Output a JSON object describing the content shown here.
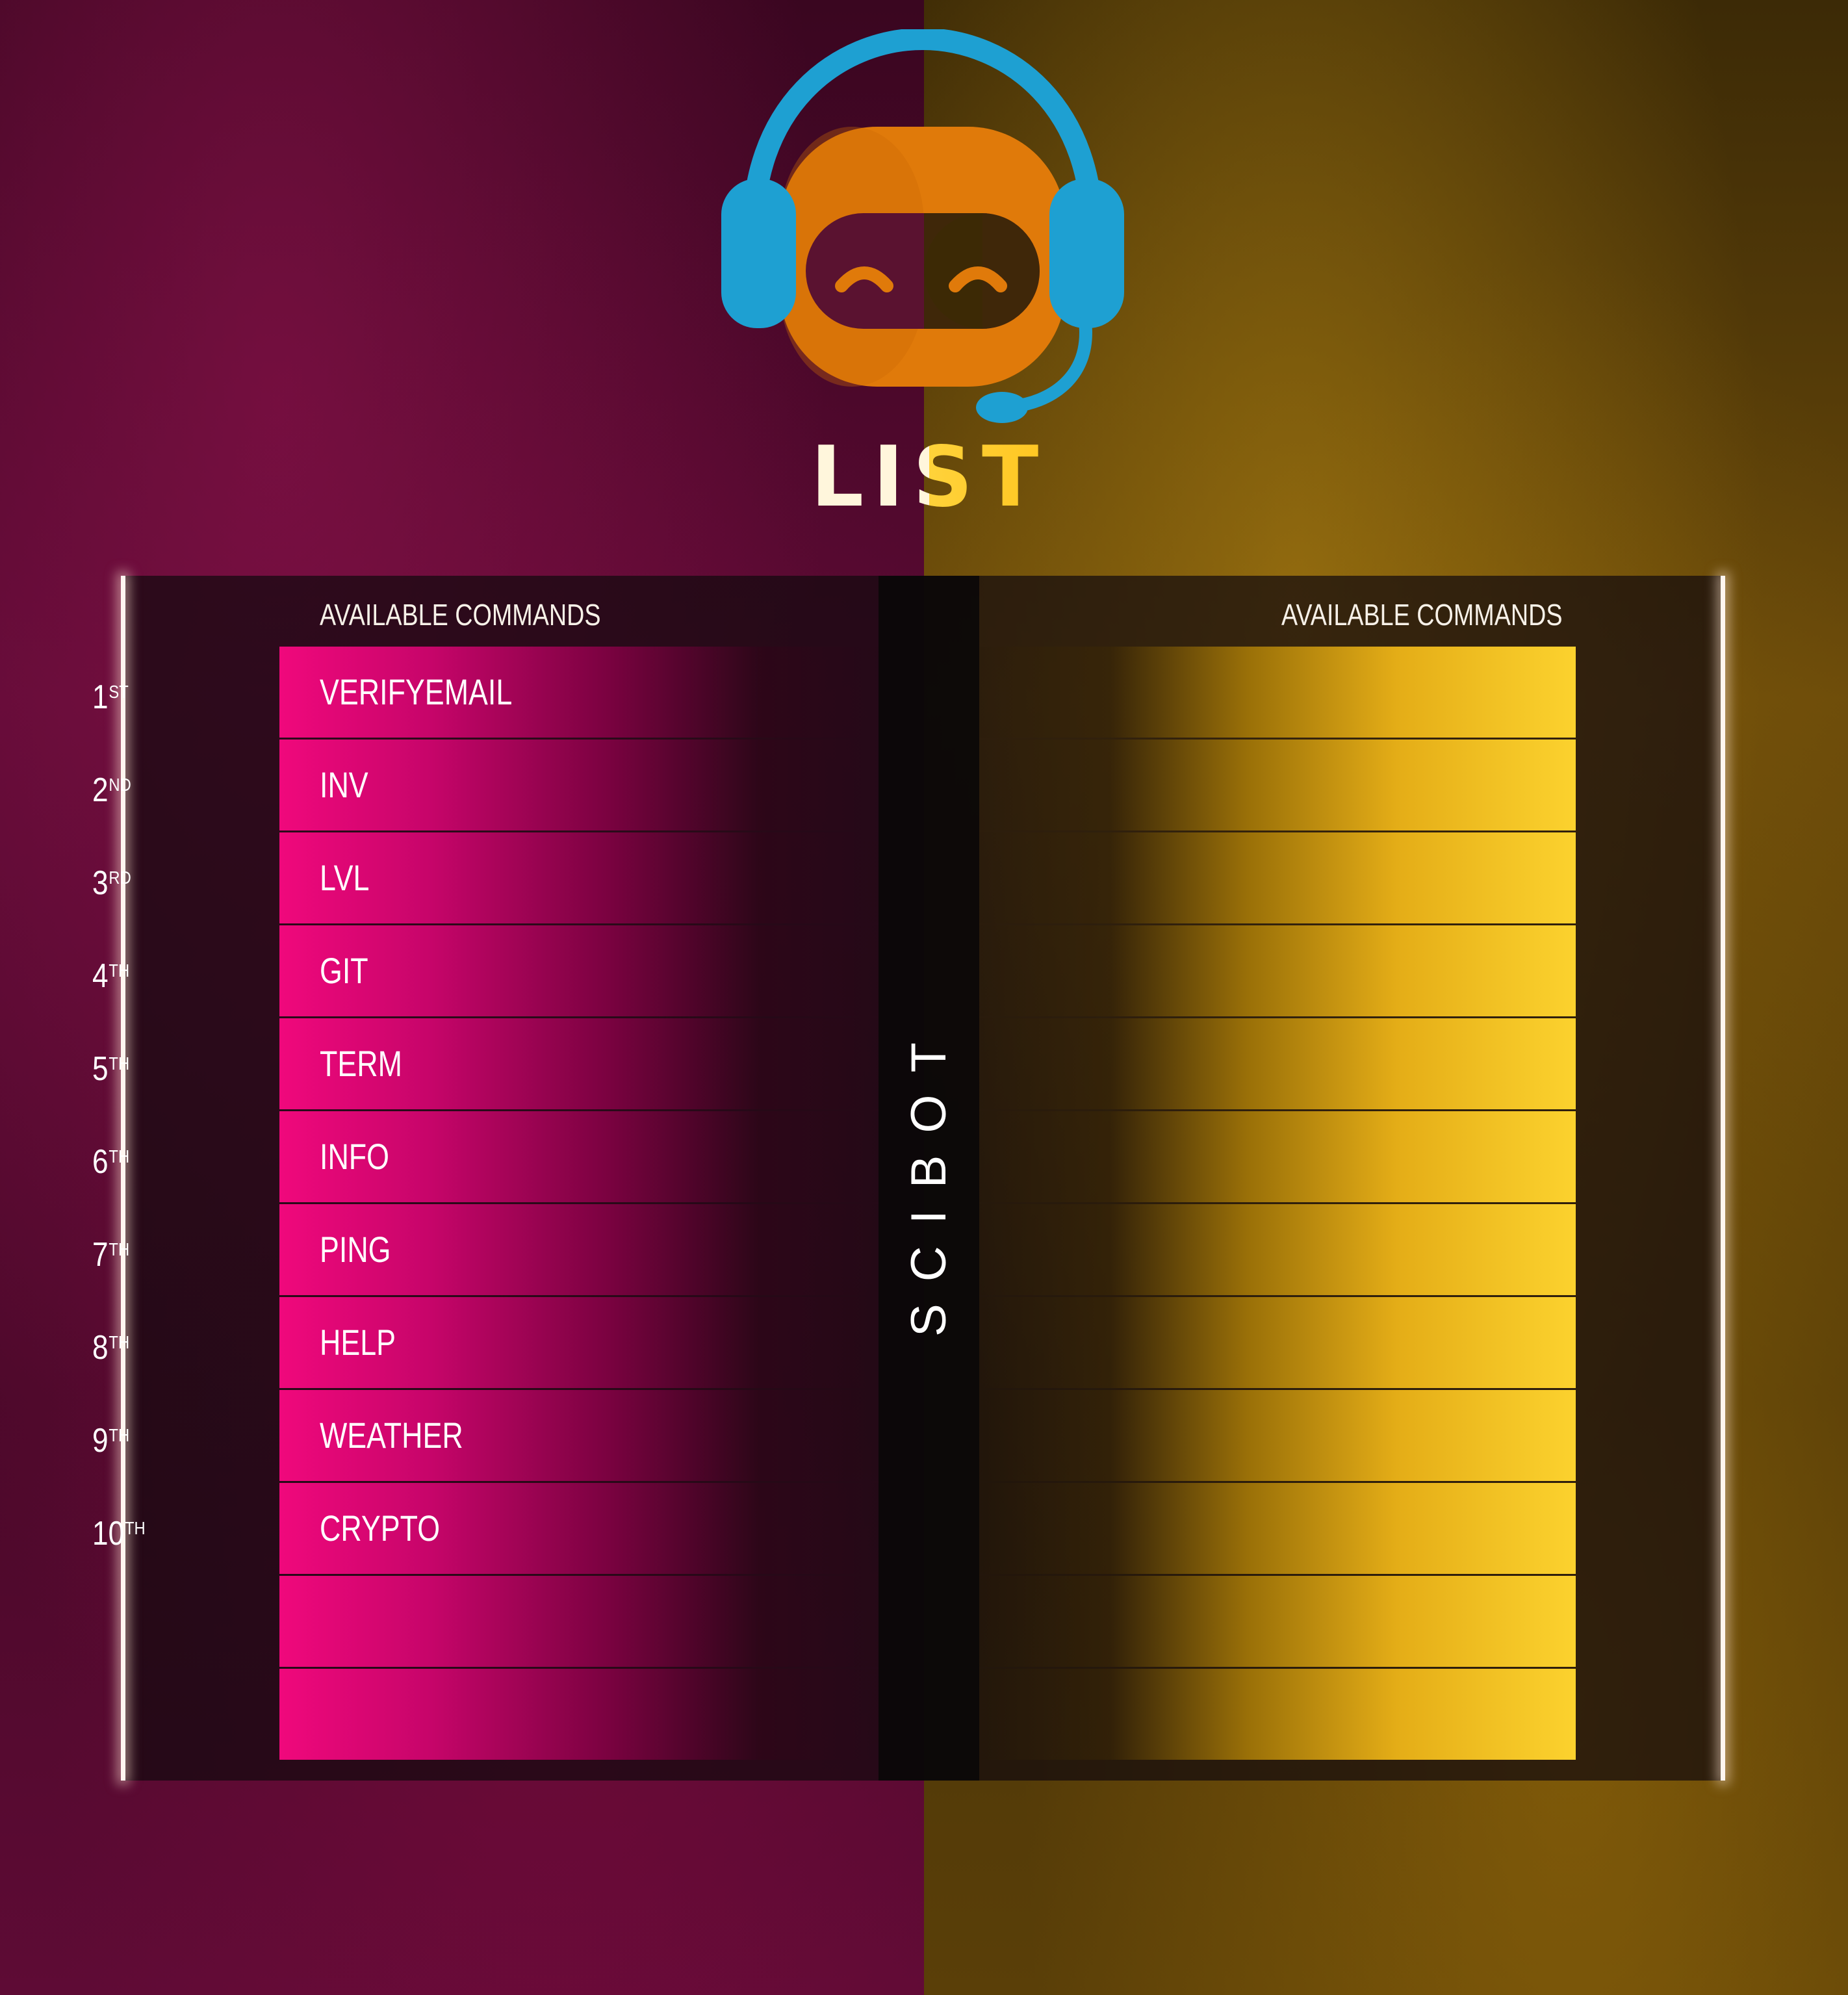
{
  "title": "LIST",
  "bot_name": "SCIBOT",
  "left_header": "AVAILABLE COMMANDS",
  "right_header": "AVAILABLE COMMANDS",
  "ranks": [
    {
      "num": "1",
      "suffix": "ST"
    },
    {
      "num": "2",
      "suffix": "ND"
    },
    {
      "num": "3",
      "suffix": "RD"
    },
    {
      "num": "4",
      "suffix": "TH"
    },
    {
      "num": "5",
      "suffix": "TH"
    },
    {
      "num": "6",
      "suffix": "TH"
    },
    {
      "num": "7",
      "suffix": "TH"
    },
    {
      "num": "8",
      "suffix": "TH"
    },
    {
      "num": "9",
      "suffix": "TH"
    },
    {
      "num": "10",
      "suffix": "TH"
    }
  ],
  "commands": [
    "VERIFYEMAIL",
    "INV",
    "LVL",
    "GIT",
    "TERM",
    "INFO",
    "PING",
    "HELP",
    "WEATHER",
    "CRYPTO",
    "",
    ""
  ],
  "right_commands": [
    "",
    "",
    "",
    "",
    "",
    "",
    "",
    "",
    "",
    "",
    "",
    ""
  ],
  "colors": {
    "pink_accent": "#f0087c",
    "gold_accent": "#fcd22e",
    "headset_blue": "#1ea0d2",
    "robot_orange": "#e07a0a"
  },
  "icons": [
    "robot-headset-logo"
  ]
}
